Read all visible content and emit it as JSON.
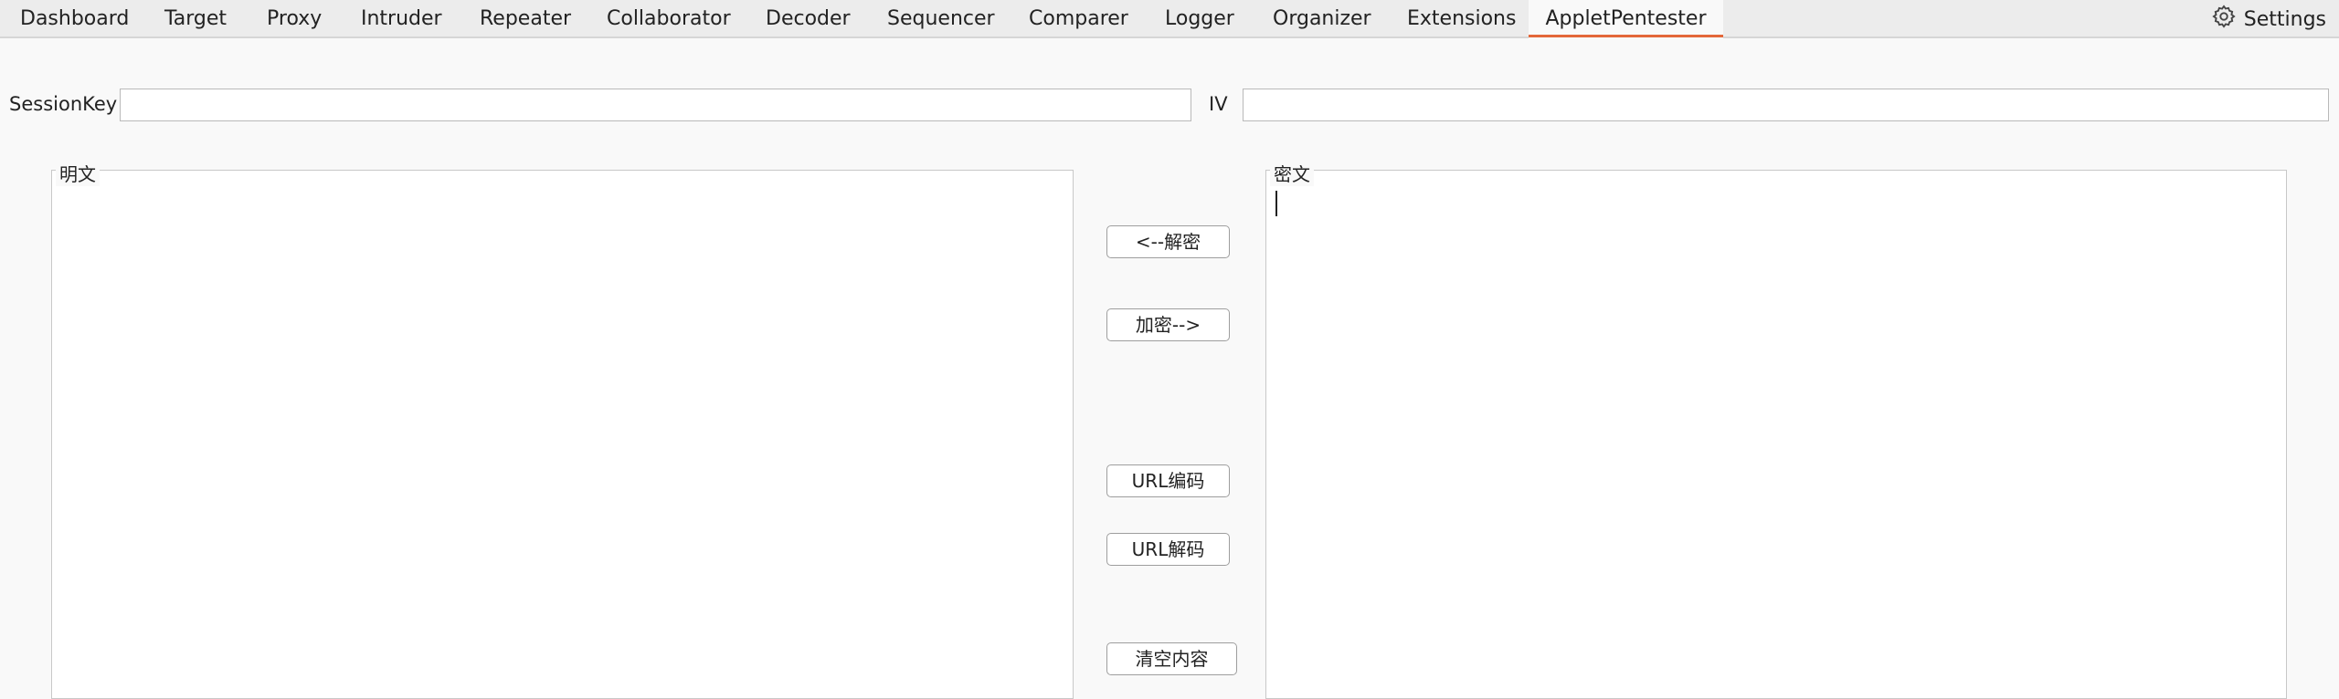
{
  "tabs": {
    "dashboard": "Dashboard",
    "target": "Target",
    "proxy": "Proxy",
    "intruder": "Intruder",
    "repeater": "Repeater",
    "collaborator": "Collaborator",
    "decoder": "Decoder",
    "sequencer": "Sequencer",
    "comparer": "Comparer",
    "logger": "Logger",
    "organizer": "Organizer",
    "extensions": "Extensions",
    "appletpentester": "AppletPentester"
  },
  "settings": {
    "label": "Settings",
    "icon": "gear-icon"
  },
  "accent_color": "#e3683a",
  "form": {
    "sessionkey_label": "SessionKey",
    "sessionkey_value": "",
    "iv_label": "IV",
    "iv_value": ""
  },
  "plaintext": {
    "title": "明文",
    "value": ""
  },
  "ciphertext": {
    "title": "密文",
    "value": ""
  },
  "buttons": {
    "decrypt": "<--解密",
    "encrypt": "加密-->",
    "url_encode": "URL编码",
    "url_decode": "URL解码",
    "clear": "清空内容"
  }
}
